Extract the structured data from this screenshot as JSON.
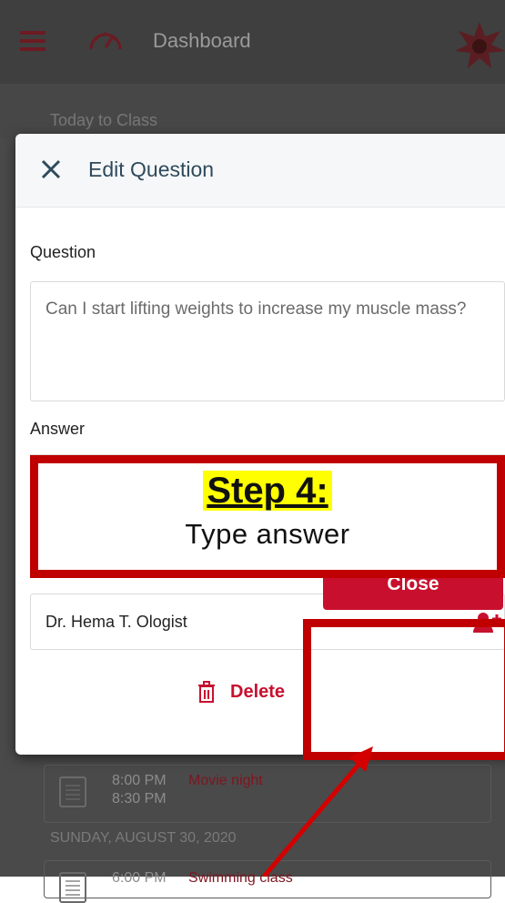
{
  "app": {
    "title": "Dashboard",
    "sub_text": "Today to Class"
  },
  "events": [
    {
      "time_start": "8:00 PM",
      "time_end": "8:30 PM",
      "title": "Movie night"
    },
    {
      "time_start": "6:00 PM",
      "title": "Swimming class"
    }
  ],
  "day_heading": "SUNDAY, AUGUST 30, 2020",
  "dialog": {
    "title": "Edit Question",
    "question_label": "Question",
    "question_value": "Can I start lifting weights to increase my muscle mass?",
    "answer_label": "Answer",
    "author_name": "Dr. Hema T. Ologist",
    "delete_label": "Delete",
    "close_label": "Close"
  },
  "annotation": {
    "step_heading": "Step 4:",
    "step_text": "Type answer"
  },
  "colors": {
    "accent": "#c8102e",
    "annotation_red": "#c00000",
    "highlight_yellow": "#ffff00",
    "title_blue": "#2e4a5c"
  }
}
